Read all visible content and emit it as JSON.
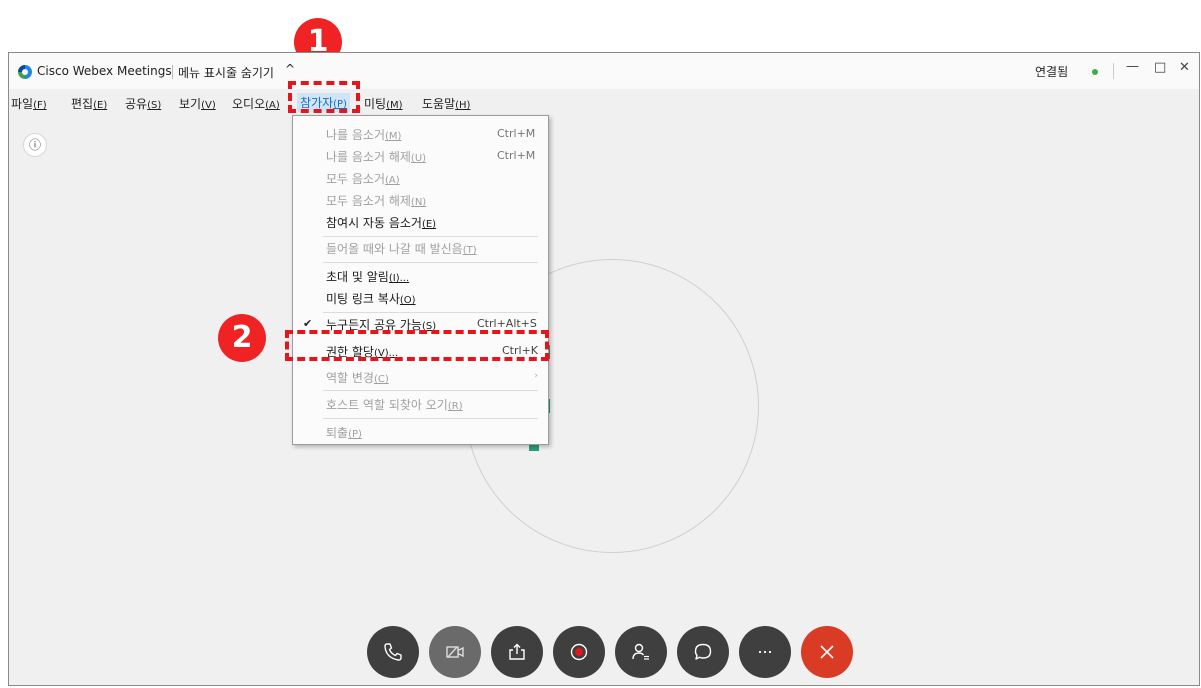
{
  "annotations": {
    "step1": "1",
    "step2": "2",
    "highlight_color": "#e8141b"
  },
  "titlebar": {
    "app_name": "Cisco Webex Meetings",
    "hide_menu": "메뉴 표시줄 숨기기",
    "caret": "^",
    "status": "연결됨",
    "status_color": "#3cb043",
    "minimize": "—",
    "maximize": "□",
    "close": "✕"
  },
  "menubar": {
    "file": {
      "label": "파일",
      "key": "(F)"
    },
    "edit": {
      "label": "편집",
      "key": "(E)"
    },
    "share": {
      "label": "공유",
      "key": "(S)"
    },
    "view": {
      "label": "보기",
      "key": "(V)"
    },
    "audio": {
      "label": "오디오",
      "key": "(A)"
    },
    "participant": {
      "label": "참가자",
      "key": "(P)"
    },
    "meeting": {
      "label": "미팅",
      "key": "(M)"
    },
    "help": {
      "label": "도움말",
      "key": "(H)"
    }
  },
  "participant_menu": {
    "mute_me": {
      "label": "나를 음소거",
      "key": "(M)",
      "shortcut": "Ctrl+M"
    },
    "unmute_me": {
      "label": "나를 음소거 해제",
      "key": "(U)",
      "shortcut": "Ctrl+M"
    },
    "mute_all": {
      "label": "모두 음소거",
      "key": "(A)"
    },
    "unmute_all": {
      "label": "모두 음소거 해제",
      "key": "(N)"
    },
    "mute_on_entry": {
      "label": "참여시 자동 음소거",
      "key": "(E)"
    },
    "entry_exit_tone": {
      "label": "들어올 때와 나갈 때 발신음",
      "key": "(T)"
    },
    "invite": {
      "label": "초대 및 알림",
      "key": "(I)..."
    },
    "copy_link": {
      "label": "미팅 링크 복사",
      "key": "(O)"
    },
    "anyone_share": {
      "label": "누구든지 공유 가능",
      "key": "(S)",
      "shortcut": "Ctrl+Alt+S",
      "check": "✔"
    },
    "assign_privileges": {
      "label": "권한 할당",
      "key": "(V)...",
      "shortcut": "Ctrl+K"
    },
    "change_role": {
      "label": "역할 변경",
      "key": "(C)",
      "arrow": "›"
    },
    "reclaim_host": {
      "label": "호스트 역할 되찾아 오기",
      "key": "(R)"
    },
    "expel": {
      "label": "퇴출",
      "key": "(P)"
    }
  },
  "info_icon": "ⓘ",
  "toolbar": {
    "icons": [
      "phone-icon",
      "video-off-icon",
      "share-icon",
      "record-icon",
      "participants-icon",
      "chat-icon",
      "more-icon",
      "leave-icon"
    ],
    "more_label": "···",
    "leave_color": "#d93b25"
  }
}
